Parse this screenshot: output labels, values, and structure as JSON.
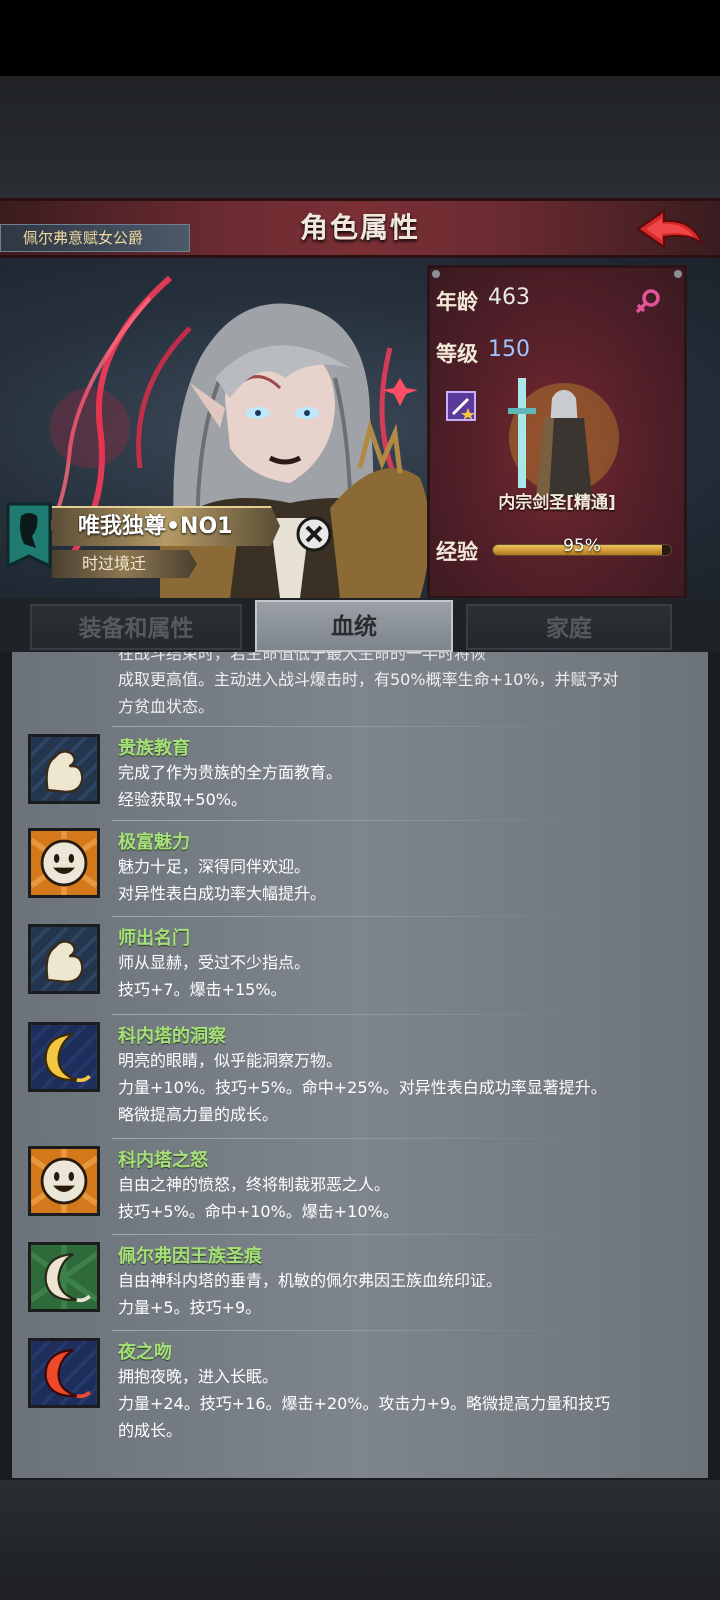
{
  "header": {
    "title": "角色属性"
  },
  "character": {
    "title_badge": "佩尔弗意赋女公爵",
    "name": "唯我独尊•NO1",
    "subtitle": "时过境迁"
  },
  "stats": {
    "age_label": "年龄",
    "age_value": "463",
    "level_label": "等级",
    "level_value": "150",
    "class_name": "内宗剑圣[精通]",
    "exp_label": "经验",
    "exp_text": "95%",
    "exp_fraction": 0.95,
    "female_icon": "female-symbol-icon"
  },
  "tabs": [
    "装备和属性",
    "血统",
    "家庭"
  ],
  "active_tab": 1,
  "intro_cut": "在战斗结束时，若生命值低于最大生命的一半时将恢",
  "intro_lines": [
    "成取更高值。主动进入战斗爆击时，有50%概率生命+10%，并赋予对",
    "方贫血状态。"
  ],
  "traits": [
    {
      "name": "贵族教育",
      "desc": [
        "完成了作为贵族的全方面教育。",
        "经验获取+50%。"
      ],
      "icon": "arm-icon"
    },
    {
      "name": "极富魅力",
      "desc": [
        "魅力十足，深得同伴欢迎。",
        "对异性表白成功率大幅提升。"
      ],
      "icon": "smile-face-icon"
    },
    {
      "name": "师出名门",
      "desc": [
        "师从显赫，受过不少指点。",
        "技巧+7。爆击+15%。"
      ],
      "icon": "arm-icon"
    },
    {
      "name": "科内塔的洞察",
      "desc": [
        "明亮的眼睛，似乎能洞察万物。",
        "力量+10%。技巧+5%。命中+25%。对异性表白成功率显著提升。",
        "略微提高力量的成长。"
      ],
      "icon": "crescent-moon-icon"
    },
    {
      "name": "科内塔之怒",
      "desc": [
        "自由之神的愤怒，终将制裁邪恶之人。",
        "技巧+5%。命中+10%。爆击+10%。"
      ],
      "icon": "smile-face-icon"
    },
    {
      "name": "佩尔弗因王族圣痕",
      "desc": [
        "自由神科内塔的垂青，机敏的佩尔弗因王族血统印证。",
        "力量+5。技巧+9。"
      ],
      "icon": "crescent-moon-icon"
    },
    {
      "name": "夜之吻",
      "desc": [
        "拥抱夜晚，进入长眠。",
        "力量+24。技巧+16。爆击+20%。攻击力+9。略微提高力量和技巧",
        "的成长。"
      ],
      "icon": "crescent-moon-icon"
    }
  ]
}
